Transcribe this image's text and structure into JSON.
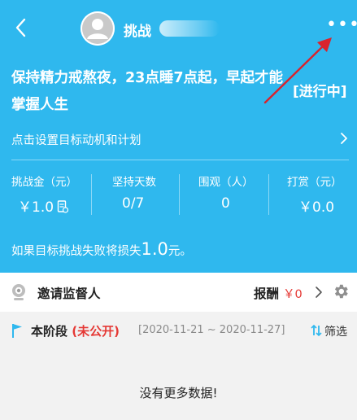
{
  "header": {
    "nickname_visible": "挑战",
    "more_glyph": "•••"
  },
  "goal": {
    "title": "保持精力戒熬夜，23点睡7点起，早起才能掌握人生",
    "status": "[进行中]"
  },
  "motivation": {
    "link_text": "点击设置目标动机和计划"
  },
  "stats": [
    {
      "label": "挑战金（元）",
      "value": "￥1.0"
    },
    {
      "label": "坚持天数",
      "value": "0/7"
    },
    {
      "label": "围观（人）",
      "value": "0"
    },
    {
      "label": "打赏（元）",
      "value": "￥0.0"
    }
  ],
  "loss_notice": {
    "prefix": "如果目标挑战失败将损失",
    "amount": "1.0",
    "suffix": "元。"
  },
  "supervisor": {
    "label": "邀请监督人",
    "reward_label": "报酬",
    "reward_value": "￥0"
  },
  "stage": {
    "label": "本阶段",
    "privacy": "(未公开)",
    "date_range": "[2020-11-21 ~ 2020-11-27]",
    "filter_label": "筛选"
  },
  "empty_message": "没有更多数据!",
  "colors": {
    "header_bg": "#2fb8ee",
    "accent_red": "#e53935",
    "annotation_red": "#d9232d"
  }
}
